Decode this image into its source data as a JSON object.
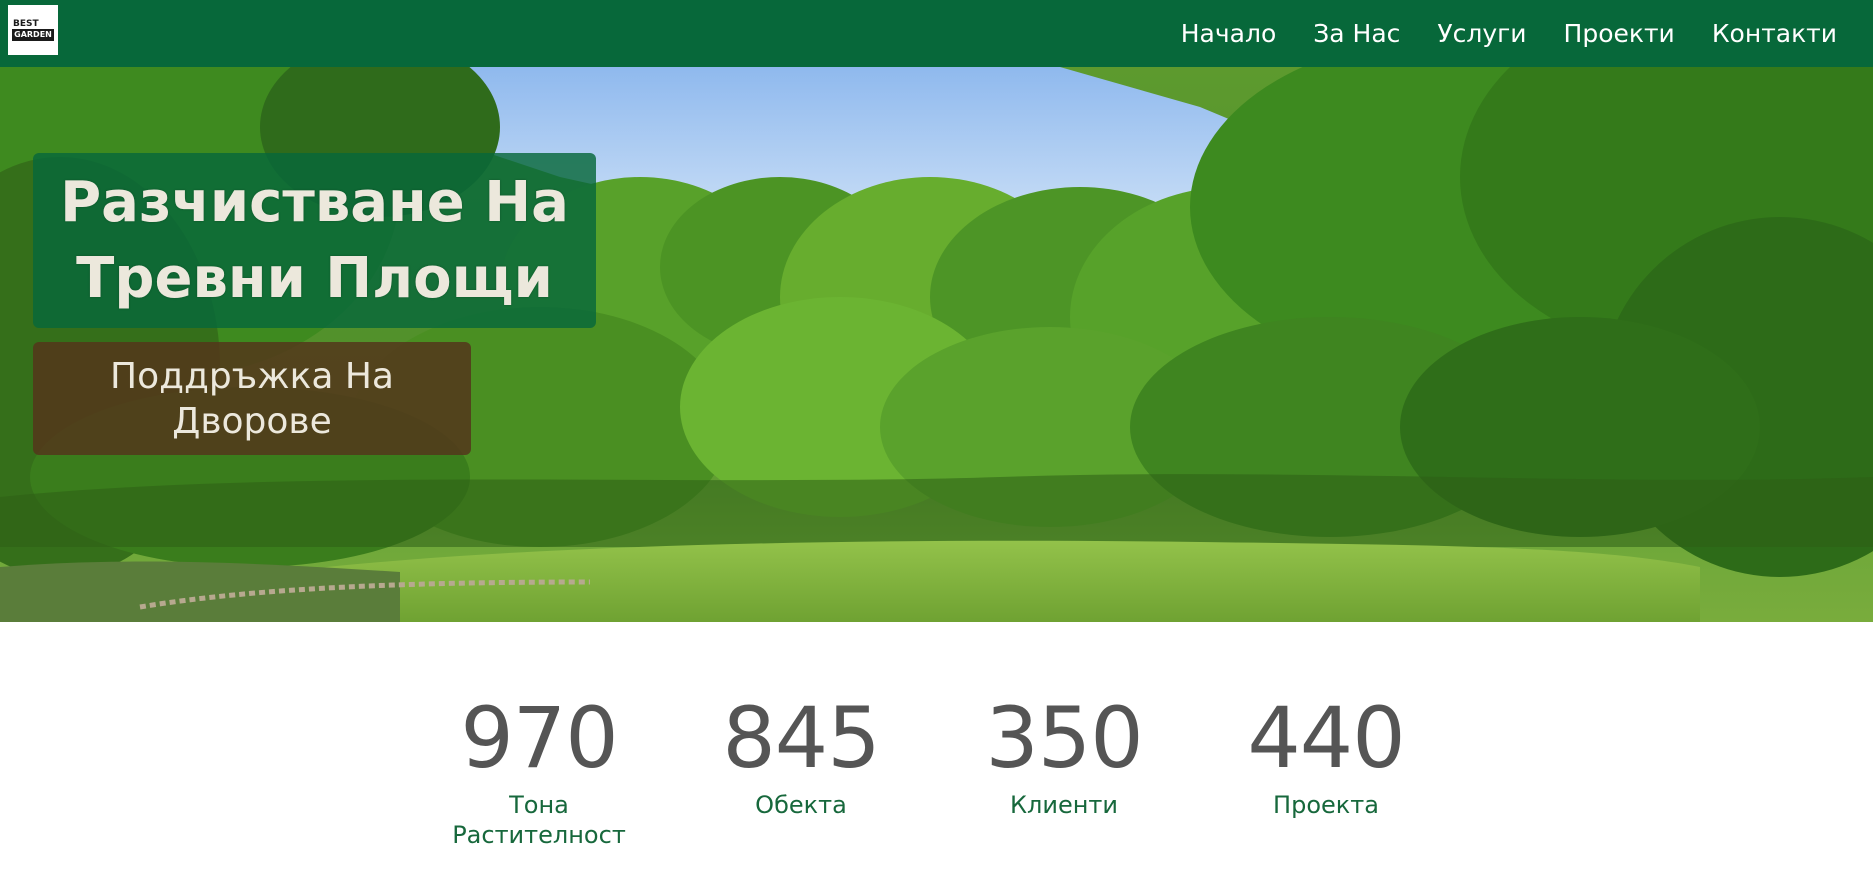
{
  "brand": {
    "logo_line1": "BEST",
    "logo_line2": "GARDEN",
    "color": "#07683a"
  },
  "nav": {
    "items": [
      "Начало",
      "За Нас",
      "Услуги",
      "Проекти",
      "Контакти"
    ]
  },
  "hero": {
    "title": "Разчистване На Тревни Площи",
    "subtitle": "Поддръжка На Дворове"
  },
  "stats": [
    {
      "value": "970",
      "label": "Тона Растителност"
    },
    {
      "value": "845",
      "label": "Обекта"
    },
    {
      "value": "350",
      "label": "Клиенти"
    },
    {
      "value": "440",
      "label": "Проекта"
    }
  ]
}
